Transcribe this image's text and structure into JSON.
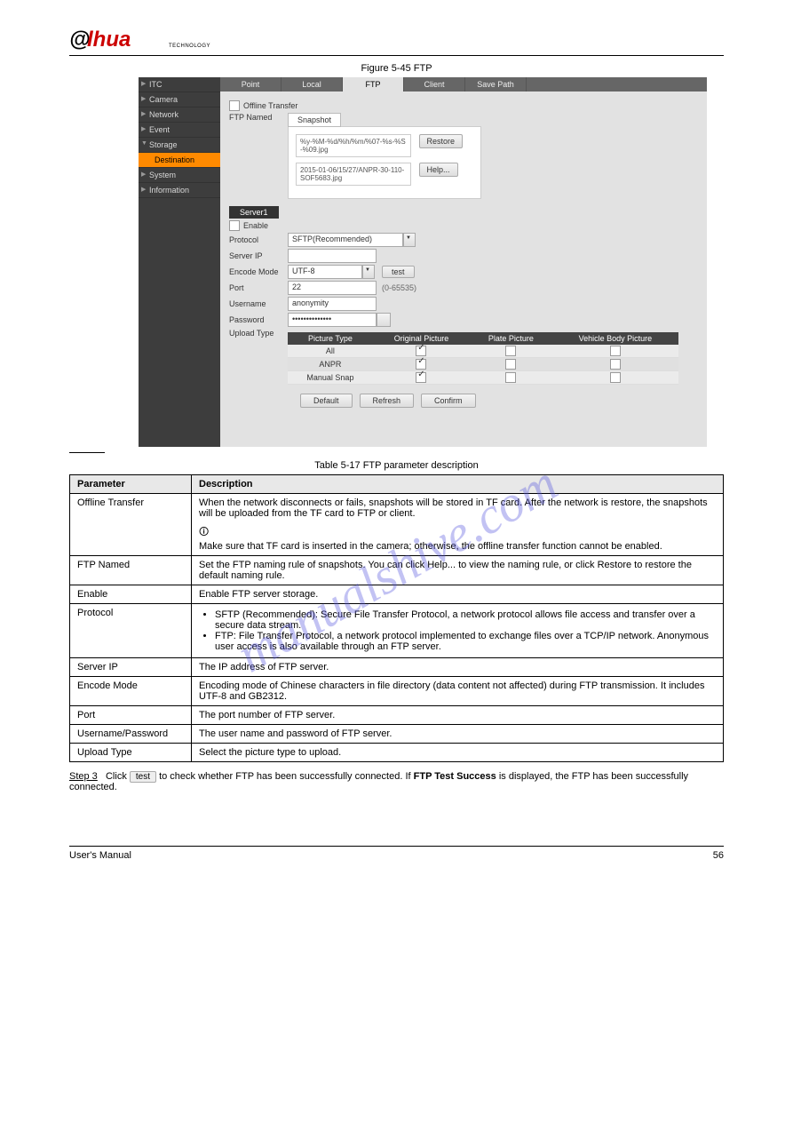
{
  "logo": {
    "tag": "TECHNOLOGY"
  },
  "watermark": "manualshive.com",
  "figure": {
    "caption": "Figure 5-45 FTP"
  },
  "sidebar": {
    "items": [
      {
        "label": "ITC"
      },
      {
        "label": "Camera"
      },
      {
        "label": "Network"
      },
      {
        "label": "Event"
      },
      {
        "label": "Storage",
        "open": true
      },
      {
        "label": "System"
      },
      {
        "label": "Information"
      }
    ],
    "sub": "Destination"
  },
  "tabs": {
    "items": [
      "Point",
      "Local",
      "FTP",
      "Client",
      "Save Path"
    ],
    "active": "FTP"
  },
  "form": {
    "offline_transfer": "Offline Transfer",
    "ftp_named": "FTP Named",
    "snapshot_tab": "Snapshot",
    "snap1": "%y-%M-%d/%h/%m/%07-%s-%S-%09.jpg",
    "snap2": "2015-01-06/15/27/ANPR-30-110-SOF5683.jpg",
    "restore": "Restore",
    "help": "Help...",
    "server1": "Server1",
    "enable": "Enable",
    "protocol": {
      "label": "Protocol",
      "value": "SFTP(Recommended)"
    },
    "server_ip": {
      "label": "Server IP",
      "value": ""
    },
    "encode_mode": {
      "label": "Encode Mode",
      "value": "UTF-8",
      "test": "test"
    },
    "port": {
      "label": "Port",
      "value": "22",
      "hint": "(0-65535)"
    },
    "username": {
      "label": "Username",
      "value": "anonymity"
    },
    "password": {
      "label": "Password",
      "value": "••••••••••••••"
    },
    "upload_type": {
      "label": "Upload Type"
    },
    "upload_hdr": [
      "Picture Type",
      "Original Picture",
      "Plate Picture",
      "Vehicle Body Picture"
    ],
    "upload_rows": [
      {
        "type": "All",
        "checks": [
          true,
          false,
          false
        ]
      },
      {
        "type": "ANPR",
        "checks": [
          true,
          false,
          false
        ]
      },
      {
        "type": "Manual Snap",
        "checks": [
          true,
          false,
          false
        ]
      }
    ],
    "btns": {
      "default": "Default",
      "refresh": "Refresh",
      "confirm": "Confirm"
    }
  },
  "table": {
    "caption": "Table 5-17 FTP parameter description",
    "h1": "Parameter",
    "h2": "Description",
    "rows": [
      {
        "p": "Offline Transfer",
        "d": "When the network disconnects or fails, snapshots will be stored in TF card. After the network is restore, the snapshots will be uploaded from the TF card to FTP or client.",
        "note": "Make sure that TF card is inserted in the camera; otherwise, the offline transfer function cannot be enabled."
      },
      {
        "p": "FTP Named",
        "d": "Set the FTP naming rule of snapshots. You can click Help... to view the naming rule, or click Restore to restore the default naming rule."
      },
      {
        "p": "Enable",
        "d": "Enable FTP server storage."
      },
      {
        "p": "Protocol",
        "d_html": "<ul style='margin:2px 0 2px 18px;padding:0'><li>SFTP (Recommended): Secure File Transfer Protocol, a network protocol allows file access and transfer over a secure data stream.</li><li>FTP: File Transfer Protocol, a network protocol implemented to exchange files over a TCP/IP network. Anonymous user access is also available through an FTP server.</li></ul>"
      },
      {
        "p": "Server IP",
        "d": "The IP address of FTP server."
      },
      {
        "p": "Encode Mode",
        "d": "Encoding mode of Chinese characters in file directory (data content not affected) during FTP transmission. It includes UTF-8 and GB2312."
      },
      {
        "p": "Port",
        "d": "The port number of FTP server."
      },
      {
        "p": "Username/Password",
        "d": "The user name and password of FTP server."
      },
      {
        "p": "Upload Type",
        "d": "Select the picture type to upload."
      }
    ]
  },
  "step3": {
    "label": "Step 3",
    "text1": "Click ",
    "btn": "test",
    "text2": " to check whether FTP has been successfully connected. If ",
    "msg": "FTP Test Success",
    "text3": " is displayed, the FTP has been successfully connected."
  },
  "footer": {
    "left": "User's Manual",
    "right": "56"
  }
}
